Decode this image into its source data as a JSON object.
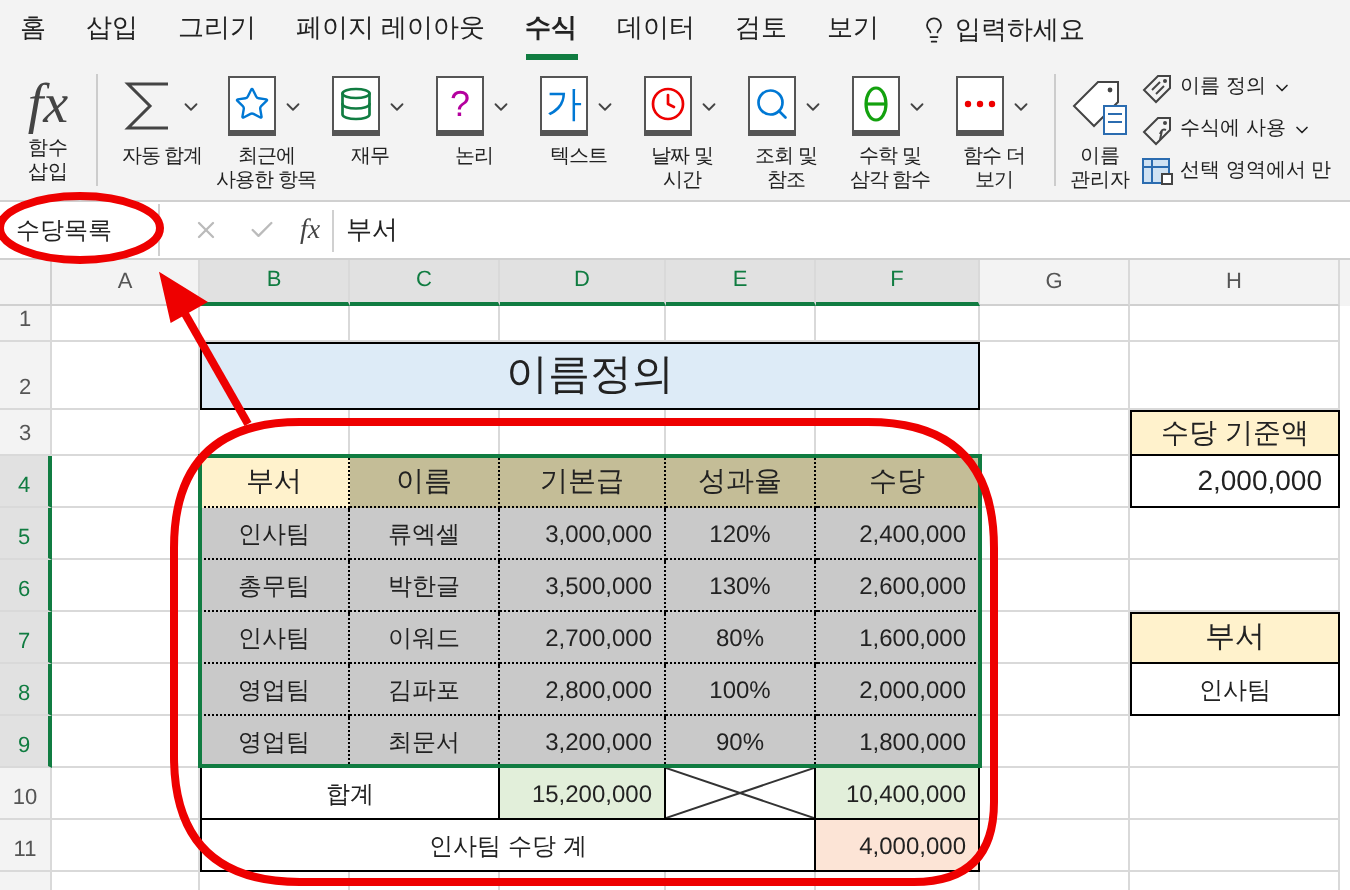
{
  "ribbon_tabs": [
    {
      "label": "홈",
      "selected": false
    },
    {
      "label": "삽입",
      "selected": false
    },
    {
      "label": "그리기",
      "selected": false
    },
    {
      "label": "페이지 레이아웃",
      "selected": false
    },
    {
      "label": "수식",
      "selected": true
    },
    {
      "label": "데이터",
      "selected": false
    },
    {
      "label": "검토",
      "selected": false
    },
    {
      "label": "보기",
      "selected": false
    }
  ],
  "tell_me": {
    "label": "입력하세요"
  },
  "ribbon": {
    "insert_function": {
      "glyph": "fx",
      "label": [
        "함수",
        "삽입"
      ]
    },
    "function_groups": [
      {
        "kind": "sum",
        "label": [
          "자동 합계"
        ]
      },
      {
        "kind": "star",
        "label": [
          "최근에",
          "사용한 항목"
        ]
      },
      {
        "kind": "database",
        "label": [
          "재무"
        ]
      },
      {
        "kind": "glyph",
        "glyph": "?",
        "color": "#b4009e",
        "label": [
          "논리"
        ]
      },
      {
        "kind": "glyph",
        "glyph": "가",
        "color": "#0078d4",
        "label": [
          "텍스트"
        ]
      },
      {
        "kind": "clock",
        "label": [
          "날짜 및",
          "시간"
        ]
      },
      {
        "kind": "search",
        "label": [
          "조회 및",
          "참조"
        ]
      },
      {
        "kind": "theta",
        "label": [
          "수학 및",
          "삼각 함수"
        ]
      },
      {
        "kind": "dots",
        "label": [
          "함수 더",
          "보기"
        ]
      }
    ],
    "name_manager": {
      "label": [
        "이름",
        "관리자"
      ]
    },
    "name_commands": [
      {
        "kind": "tag",
        "label": "이름 정의",
        "dropdown": true
      },
      {
        "kind": "tag-fx",
        "label": "수식에 사용",
        "dropdown": true
      },
      {
        "kind": "grid",
        "label": "선택 영역에서 만",
        "dropdown": false
      }
    ]
  },
  "formula_bar": {
    "name_box": "수당목록",
    "fx": "fx",
    "content": "부서"
  },
  "columns": [
    {
      "label": "A",
      "selected": false
    },
    {
      "label": "B",
      "selected": true
    },
    {
      "label": "C",
      "selected": true
    },
    {
      "label": "D",
      "selected": true
    },
    {
      "label": "E",
      "selected": true
    },
    {
      "label": "F",
      "selected": true
    },
    {
      "label": "G",
      "selected": false
    },
    {
      "label": "H",
      "selected": false
    }
  ],
  "rows": [
    {
      "label": "1",
      "selected": false
    },
    {
      "label": "2",
      "selected": false
    },
    {
      "label": "3",
      "selected": false
    },
    {
      "label": "4",
      "selected": true
    },
    {
      "label": "5",
      "selected": true
    },
    {
      "label": "6",
      "selected": true
    },
    {
      "label": "7",
      "selected": true
    },
    {
      "label": "8",
      "selected": true
    },
    {
      "label": "9",
      "selected": true
    },
    {
      "label": "10",
      "selected": false
    },
    {
      "label": "11",
      "selected": false
    }
  ],
  "sheet": {
    "title": "이름정의",
    "headers": [
      "부서",
      "이름",
      "기본급",
      "성과율",
      "수당"
    ],
    "records": [
      [
        "인사팀",
        "류엑셀",
        "3,000,000",
        "120%",
        "2,400,000"
      ],
      [
        "총무팀",
        "박한글",
        "3,500,000",
        "130%",
        "2,600,000"
      ],
      [
        "인사팀",
        "이워드",
        "2,700,000",
        "80%",
        "1,600,000"
      ],
      [
        "영업팀",
        "김파포",
        "2,800,000",
        "100%",
        "2,000,000"
      ],
      [
        "영업팀",
        "최문서",
        "3,200,000",
        "90%",
        "1,800,000"
      ]
    ],
    "total": {
      "label": "합계",
      "base": "15,200,000",
      "allowance": "10,400,000"
    },
    "dept_total": {
      "label": "인사팀 수당 계",
      "value": "4,000,000"
    },
    "criteria": {
      "label": "수당 기준액",
      "value": "2,000,000"
    },
    "dept_lookup": {
      "label": "부서",
      "value": "인사팀"
    }
  }
}
